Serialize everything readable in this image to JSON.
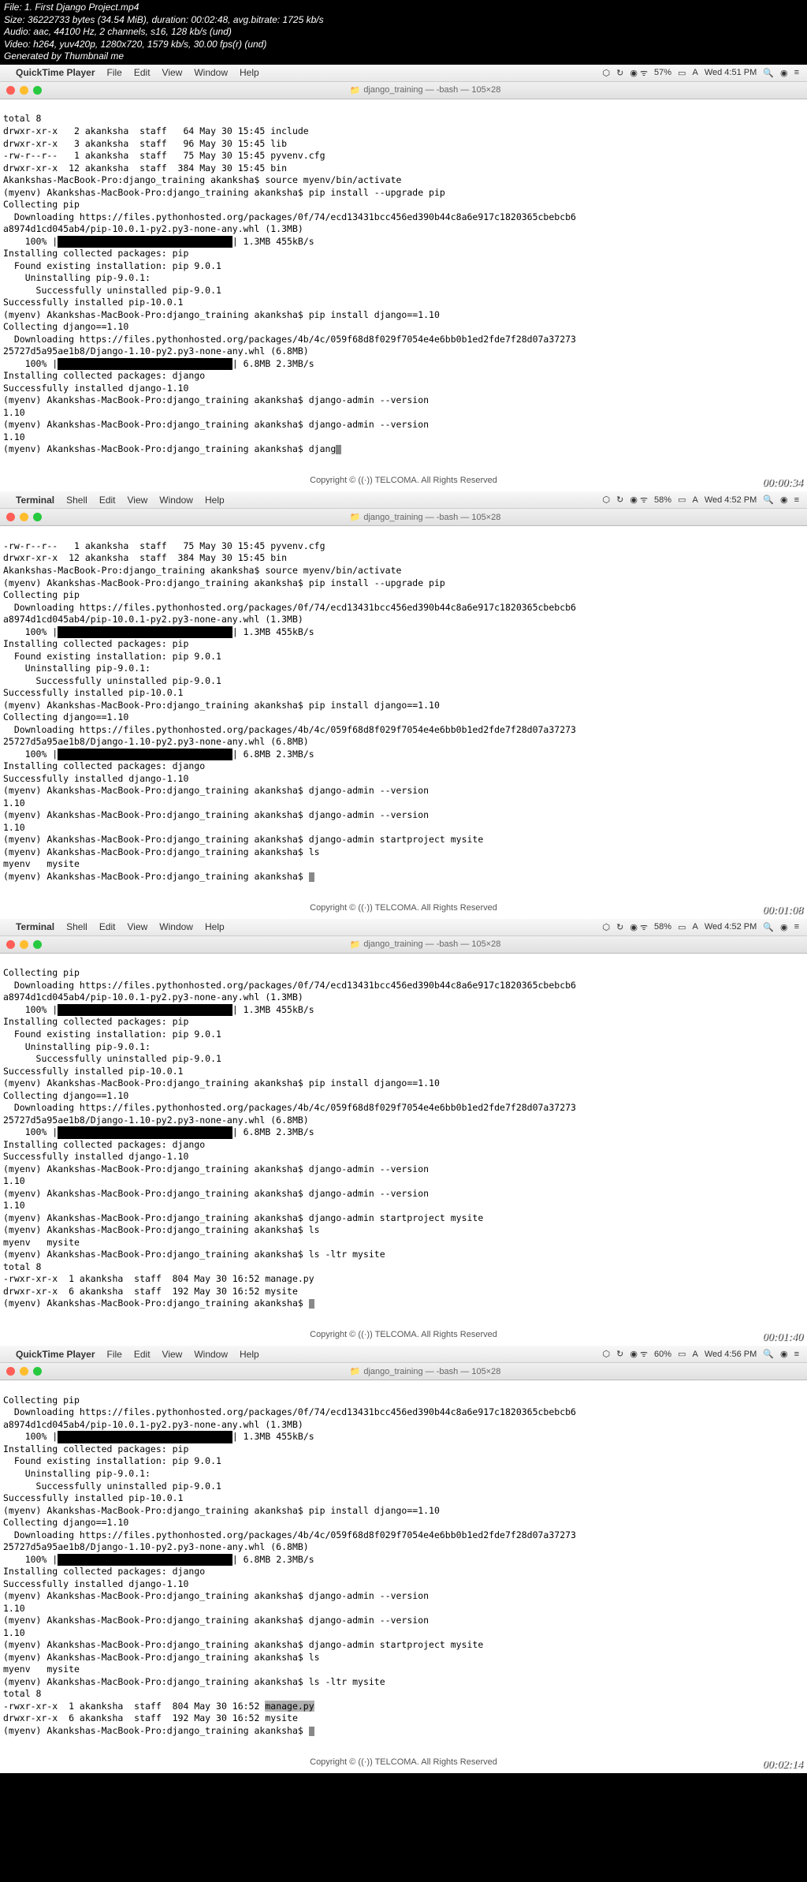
{
  "file_info": {
    "line1": "File: 1. First Django Project.mp4",
    "line2": "Size: 36222733 bytes (34.54 MiB), duration: 00:02:48, avg.bitrate: 1725 kb/s",
    "line3": "Audio: aac, 44100 Hz, 2 channels, s16, 128 kb/s (und)",
    "line4": "Video: h264, yuv420p, 1280x720, 1579 kb/s, 30.00 fps(r) (und)",
    "line5": "Generated by Thumbnail me"
  },
  "menubar": {
    "apple": "",
    "app_quicktime": "QuickTime Player",
    "app_terminal": "Terminal",
    "file": "File",
    "edit": "Edit",
    "shell": "Shell",
    "view": "View",
    "window": "Window",
    "help": "Help",
    "wifi_57": "57%",
    "wifi_58": "58%",
    "wifi_58b": "58%",
    "wifi_60": "60%",
    "battery": "⏻",
    "time_451": "Wed 4:51 PM",
    "time_452": "Wed 4:52 PM",
    "time_452b": "Wed 4:52 PM",
    "time_456": "Wed 4:56 PM"
  },
  "titlebar": {
    "folder": "📁",
    "title": "django_training — -bash — 105×28"
  },
  "copyright": "Copyright © ((·)) TELCOMA. All Rights Reserved",
  "timestamps": {
    "t1": "00:00:34",
    "t2": "00:01:08",
    "t3": "00:01:40",
    "t4": "00:02:14"
  },
  "term1": {
    "l1": "total 8",
    "l2": "drwxr-xr-x   2 akanksha  staff   64 May 30 15:45 include",
    "l3": "drwxr-xr-x   3 akanksha  staff   96 May 30 15:45 lib",
    "l4": "-rw-r--r--   1 akanksha  staff   75 May 30 15:45 pyvenv.cfg",
    "l5": "drwxr-xr-x  12 akanksha  staff  384 May 30 15:45 bin",
    "l6": "Akankshas-MacBook-Pro:django_training akanksha$ source myenv/bin/activate",
    "l7": "(myenv) Akankshas-MacBook-Pro:django_training akanksha$ pip install --upgrade pip",
    "l8": "Collecting pip",
    "l9": "  Downloading https://files.pythonhosted.org/packages/0f/74/ecd13431bcc456ed390b44c8a6e917c1820365cbebcb6",
    "l10": "a8974d1cd045ab4/pip-10.0.1-py2.py3-none-any.whl (1.3MB)",
    "l11a": "    100% |",
    "l11b": "████████████████████████████████",
    "l11c": "| 1.3MB 455kB/s ",
    "l12": "Installing collected packages: pip",
    "l13": "  Found existing installation: pip 9.0.1",
    "l14": "    Uninstalling pip-9.0.1:",
    "l15": "      Successfully uninstalled pip-9.0.1",
    "l16": "Successfully installed pip-10.0.1",
    "l17": "(myenv) Akankshas-MacBook-Pro:django_training akanksha$ pip install django==1.10",
    "l18": "Collecting django==1.10",
    "l19": "  Downloading https://files.pythonhosted.org/packages/4b/4c/059f68d8f029f7054e4e6bb0b1ed2fde7f28d07a37273",
    "l20": "25727d5a95ae1b8/Django-1.10-py2.py3-none-any.whl (6.8MB)",
    "l21a": "    100% |",
    "l21b": "████████████████████████████████",
    "l21c": "| 6.8MB 2.3MB/s ",
    "l22": "Installing collected packages: django",
    "l23": "Successfully installed django-1.10",
    "l24": "(myenv) Akankshas-MacBook-Pro:django_training akanksha$ django-admin --version",
    "l25": "1.10",
    "l26": "(myenv) Akankshas-MacBook-Pro:django_training akanksha$ django-admin --version",
    "l27": "1.10",
    "l28": "(myenv) Akankshas-MacBook-Pro:django_training akanksha$ djang"
  },
  "term2": {
    "l1": "-rw-r--r--   1 akanksha  staff   75 May 30 15:45 pyvenv.cfg",
    "l2": "drwxr-xr-x  12 akanksha  staff  384 May 30 15:45 bin",
    "l3": "Akankshas-MacBook-Pro:django_training akanksha$ source myenv/bin/activate",
    "l4": "(myenv) Akankshas-MacBook-Pro:django_training akanksha$ pip install --upgrade pip",
    "l5": "Collecting pip",
    "l6": "  Downloading https://files.pythonhosted.org/packages/0f/74/ecd13431bcc456ed390b44c8a6e917c1820365cbebcb6",
    "l7": "a8974d1cd045ab4/pip-10.0.1-py2.py3-none-any.whl (1.3MB)",
    "l8a": "    100% |",
    "l8b": "████████████████████████████████",
    "l8c": "| 1.3MB 455kB/s ",
    "l9": "Installing collected packages: pip",
    "l10": "  Found existing installation: pip 9.0.1",
    "l11": "    Uninstalling pip-9.0.1:",
    "l12": "      Successfully uninstalled pip-9.0.1",
    "l13": "Successfully installed pip-10.0.1",
    "l14": "(myenv) Akankshas-MacBook-Pro:django_training akanksha$ pip install django==1.10",
    "l15": "Collecting django==1.10",
    "l16": "  Downloading https://files.pythonhosted.org/packages/4b/4c/059f68d8f029f7054e4e6bb0b1ed2fde7f28d07a37273",
    "l17": "25727d5a95ae1b8/Django-1.10-py2.py3-none-any.whl (6.8MB)",
    "l18a": "    100% |",
    "l18b": "████████████████████████████████",
    "l18c": "| 6.8MB 2.3MB/s ",
    "l19": "Installing collected packages: django",
    "l20": "Successfully installed django-1.10",
    "l21": "(myenv) Akankshas-MacBook-Pro:django_training akanksha$ django-admin --version",
    "l22": "1.10",
    "l23": "(myenv) Akankshas-MacBook-Pro:django_training akanksha$ django-admin --version",
    "l24": "1.10",
    "l25": "(myenv) Akankshas-MacBook-Pro:django_training akanksha$ django-admin startproject mysite",
    "l26": "(myenv) Akankshas-MacBook-Pro:django_training akanksha$ ls",
    "l27": "myenv   mysite",
    "l28": "(myenv) Akankshas-MacBook-Pro:django_training akanksha$ "
  },
  "term3": {
    "l1": "Collecting pip",
    "l2": "  Downloading https://files.pythonhosted.org/packages/0f/74/ecd13431bcc456ed390b44c8a6e917c1820365cbebcb6",
    "l3": "a8974d1cd045ab4/pip-10.0.1-py2.py3-none-any.whl (1.3MB)",
    "l4a": "    100% |",
    "l4b": "████████████████████████████████",
    "l4c": "| 1.3MB 455kB/s ",
    "l5": "Installing collected packages: pip",
    "l6": "  Found existing installation: pip 9.0.1",
    "l7": "    Uninstalling pip-9.0.1:",
    "l8": "      Successfully uninstalled pip-9.0.1",
    "l9": "Successfully installed pip-10.0.1",
    "l10": "(myenv) Akankshas-MacBook-Pro:django_training akanksha$ pip install django==1.10",
    "l11": "Collecting django==1.10",
    "l12": "  Downloading https://files.pythonhosted.org/packages/4b/4c/059f68d8f029f7054e4e6bb0b1ed2fde7f28d07a37273",
    "l13": "25727d5a95ae1b8/Django-1.10-py2.py3-none-any.whl (6.8MB)",
    "l14a": "    100% |",
    "l14b": "████████████████████████████████",
    "l14c": "| 6.8MB 2.3MB/s ",
    "l15": "Installing collected packages: django",
    "l16": "Successfully installed django-1.10",
    "l17": "(myenv) Akankshas-MacBook-Pro:django_training akanksha$ django-admin --version",
    "l18": "1.10",
    "l19": "(myenv) Akankshas-MacBook-Pro:django_training akanksha$ django-admin --version",
    "l20": "1.10",
    "l21": "(myenv) Akankshas-MacBook-Pro:django_training akanksha$ django-admin startproject mysite",
    "l22": "(myenv) Akankshas-MacBook-Pro:django_training akanksha$ ls",
    "l23": "myenv   mysite",
    "l24": "(myenv) Akankshas-MacBook-Pro:django_training akanksha$ ls -ltr mysite",
    "l25": "total 8",
    "l26": "-rwxr-xr-x  1 akanksha  staff  804 May 30 16:52 manage.py",
    "l27": "drwxr-xr-x  6 akanksha  staff  192 May 30 16:52 mysite",
    "l28": "(myenv) Akankshas-MacBook-Pro:django_training akanksha$ "
  },
  "term4": {
    "l1": "Collecting pip",
    "l2": "  Downloading https://files.pythonhosted.org/packages/0f/74/ecd13431bcc456ed390b44c8a6e917c1820365cbebcb6",
    "l3": "a8974d1cd045ab4/pip-10.0.1-py2.py3-none-any.whl (1.3MB)",
    "l4a": "    100% |",
    "l4b": "████████████████████████████████",
    "l4c": "| 1.3MB 455kB/s ",
    "l5": "Installing collected packages: pip",
    "l6": "  Found existing installation: pip 9.0.1",
    "l7": "    Uninstalling pip-9.0.1:",
    "l8": "      Successfully uninstalled pip-9.0.1",
    "l9": "Successfully installed pip-10.0.1",
    "l10": "(myenv) Akankshas-MacBook-Pro:django_training akanksha$ pip install django==1.10",
    "l11": "Collecting django==1.10",
    "l12": "  Downloading https://files.pythonhosted.org/packages/4b/4c/059f68d8f029f7054e4e6bb0b1ed2fde7f28d07a37273",
    "l13": "25727d5a95ae1b8/Django-1.10-py2.py3-none-any.whl (6.8MB)",
    "l14a": "    100% |",
    "l14b": "████████████████████████████████",
    "l14c": "| 6.8MB 2.3MB/s ",
    "l15": "Installing collected packages: django",
    "l16": "Successfully installed django-1.10",
    "l17": "(myenv) Akankshas-MacBook-Pro:django_training akanksha$ django-admin --version",
    "l18": "1.10",
    "l19": "(myenv) Akankshas-MacBook-Pro:django_training akanksha$ django-admin --version",
    "l20": "1.10",
    "l21": "(myenv) Akankshas-MacBook-Pro:django_training akanksha$ django-admin startproject mysite",
    "l22": "(myenv) Akankshas-MacBook-Pro:django_training akanksha$ ls",
    "l23": "myenv   mysite",
    "l24": "(myenv) Akankshas-MacBook-Pro:django_training akanksha$ ls -ltr mysite",
    "l25": "total 8",
    "l26a": "-rwxr-xr-x  1 akanksha  staff  804 May 30 16:52 ",
    "l26b": "manage.py",
    "l27": "drwxr-xr-x  6 akanksha  staff  192 May 30 16:52 mysite",
    "l28": "(myenv) Akankshas-MacBook-Pro:django_training akanksha$ "
  }
}
